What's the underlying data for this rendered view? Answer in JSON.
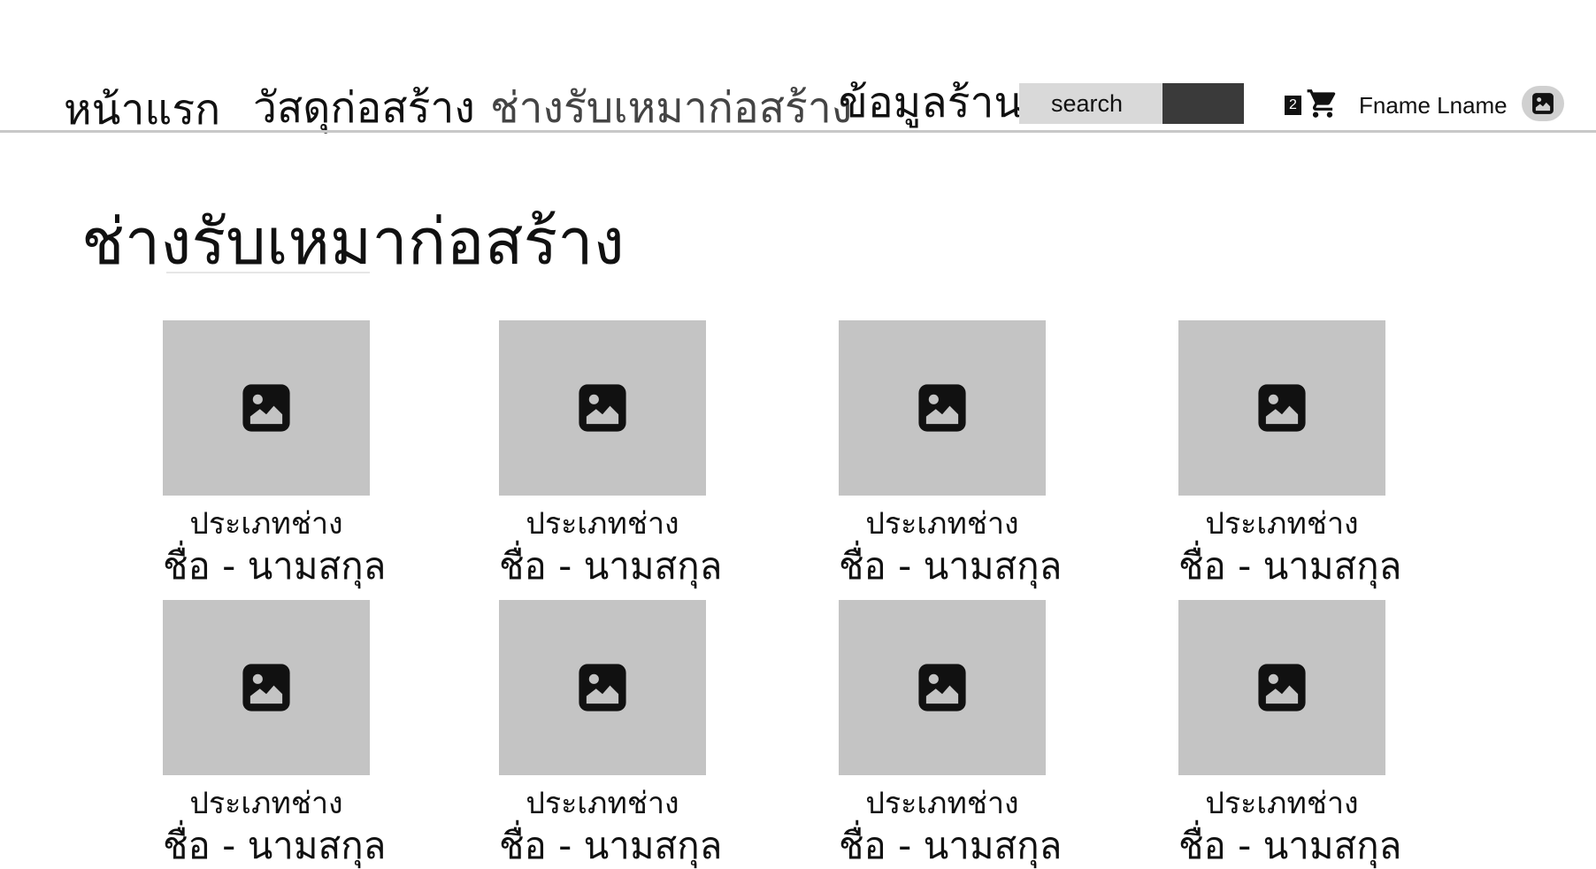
{
  "nav": {
    "items": [
      {
        "label": "หน้าแรก"
      },
      {
        "label": "วัสดุก่อสร้าง"
      },
      {
        "label": "ช่างรับเหมาก่อสร้าง"
      },
      {
        "label": "ข้อมูลร้าน"
      }
    ]
  },
  "search": {
    "placeholder": "search"
  },
  "cart": {
    "count": "2",
    "icon": "cart-icon"
  },
  "user": {
    "name": "Fname Lname",
    "avatar_icon": "image-icon"
  },
  "page": {
    "title": "ช่างรับเหมาก่อสร้าง"
  },
  "contractors": [
    {
      "type": "ประเภทช่าง",
      "name": "ชื่อ - นามสกุล"
    },
    {
      "type": "ประเภทช่าง",
      "name": "ชื่อ - นามสกุล"
    },
    {
      "type": "ประเภทช่าง",
      "name": "ชื่อ - นามสกุล"
    },
    {
      "type": "ประเภทช่าง",
      "name": "ชื่อ - นามสกุล"
    },
    {
      "type": "ประเภทช่าง",
      "name": "ชื่อ - นามสกุล"
    },
    {
      "type": "ประเภทช่าง",
      "name": "ชื่อ - นามสกุล"
    },
    {
      "type": "ประเภทช่าง",
      "name": "ชื่อ - นามสกุล"
    },
    {
      "type": "ประเภทช่าง",
      "name": "ชื่อ - นามสกุล"
    }
  ],
  "colors": {
    "placeholder_image": "#c4c4c4",
    "search_field": "#d9d9d9",
    "search_button": "#3a3a3a",
    "divider": "#c8c8c8"
  }
}
